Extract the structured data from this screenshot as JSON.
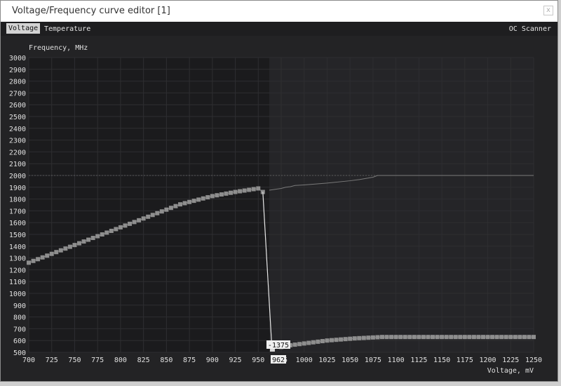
{
  "window": {
    "title": "Voltage/Frequency curve editor [1]",
    "close_glyph": "x"
  },
  "tabs": {
    "voltage": "Voltage",
    "temperature": "Temperature",
    "oc_scanner": "OC Scanner"
  },
  "chart_data": {
    "type": "line",
    "xlabel": "Voltage, mV",
    "ylabel": "Frequency, MHz",
    "xlim": [
      700,
      1250
    ],
    "ylim": [
      500,
      3000
    ],
    "x_ticks": [
      "700",
      "725",
      "750",
      "775",
      "800",
      "825",
      "850",
      "875",
      "900",
      "925",
      "950",
      "975",
      "1000",
      "1025",
      "1050",
      "1075",
      "1100",
      "1125",
      "1150",
      "1175",
      "1200",
      "1225",
      "1250"
    ],
    "y_ticks": [
      "500",
      "600",
      "700",
      "800",
      "900",
      "1000",
      "1100",
      "1200",
      "1300",
      "1400",
      "1500",
      "1600",
      "1700",
      "1800",
      "1900",
      "2000",
      "2100",
      "2200",
      "2300",
      "2400",
      "2500",
      "2600",
      "2700",
      "2800",
      "2900",
      "3000"
    ],
    "reference_line": 2000,
    "selected_point": {
      "voltage": 962,
      "frequency": -1375,
      "voltage_label": "962",
      "frequency_label": "-1375"
    },
    "curve_before": {
      "voltage": [
        700,
        705,
        710,
        715,
        720,
        725,
        730,
        735,
        740,
        745,
        750,
        755,
        760,
        765,
        770,
        775,
        780,
        785,
        790,
        795,
        800,
        805,
        810,
        815,
        820,
        825,
        830,
        835,
        840,
        845,
        850,
        855,
        860,
        865,
        870,
        875,
        880,
        885,
        890,
        895,
        900,
        905,
        910,
        915,
        920,
        925,
        930,
        935,
        940,
        945,
        950,
        955
      ],
      "frequency": [
        1260,
        1275,
        1290,
        1305,
        1320,
        1335,
        1350,
        1365,
        1380,
        1395,
        1410,
        1425,
        1440,
        1455,
        1470,
        1485,
        1500,
        1515,
        1530,
        1545,
        1560,
        1575,
        1590,
        1605,
        1620,
        1635,
        1650,
        1665,
        1680,
        1695,
        1710,
        1725,
        1740,
        1755,
        1765,
        1775,
        1785,
        1795,
        1805,
        1815,
        1825,
        1832,
        1839,
        1846,
        1853,
        1860,
        1866,
        1872,
        1878,
        1884,
        1890,
        1860
      ]
    },
    "target_curve": {
      "voltage": [
        962,
        975,
        980,
        985,
        990,
        1000,
        1025,
        1050,
        1060,
        1075,
        1080,
        1100,
        1125,
        1150,
        1175,
        1200,
        1225,
        1250
      ],
      "frequency": [
        1875,
        1890,
        1900,
        1905,
        1915,
        1920,
        1935,
        1955,
        1965,
        1985,
        2000,
        2000,
        2000,
        2000,
        2000,
        2000,
        2000,
        2000
      ]
    },
    "curve_after": {
      "voltage": [
        975,
        980,
        985,
        990,
        995,
        1000,
        1005,
        1010,
        1015,
        1020,
        1025,
        1030,
        1035,
        1040,
        1045,
        1050,
        1055,
        1060,
        1065,
        1070,
        1075,
        1080,
        1085,
        1090,
        1095,
        1100,
        1105,
        1110,
        1115,
        1120,
        1125,
        1130,
        1135,
        1140,
        1145,
        1150,
        1155,
        1160,
        1165,
        1170,
        1175,
        1180,
        1185,
        1190,
        1195,
        1200,
        1205,
        1210,
        1215,
        1220,
        1225,
        1230,
        1235,
        1240,
        1245,
        1250
      ],
      "frequency": [
        545,
        555,
        560,
        565,
        570,
        575,
        580,
        585,
        590,
        595,
        600,
        603,
        606,
        609,
        612,
        615,
        618,
        620,
        622,
        624,
        626,
        628,
        630,
        630,
        630,
        630,
        630,
        630,
        630,
        630,
        630,
        630,
        630,
        630,
        630,
        630,
        630,
        630,
        630,
        630,
        630,
        630,
        630,
        630,
        630,
        630,
        630,
        630,
        630,
        630,
        630,
        630,
        630,
        630,
        630,
        630
      ]
    },
    "colors": {
      "plot_bg": "#1b1b1d",
      "shade_bg": "#252528",
      "grid": "#2e2e31",
      "curve": "#8a8a8a",
      "marker": "#8e8e8e",
      "drop_line": "#e8e8e8",
      "label_text": "#e0e0e0"
    }
  }
}
